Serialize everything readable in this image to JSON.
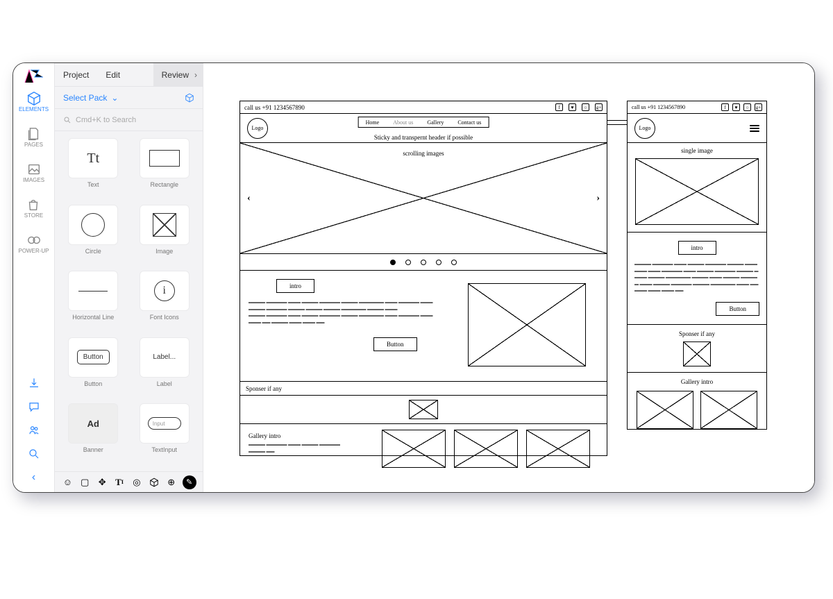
{
  "rail": {
    "items": [
      {
        "label": "ELEMENTS"
      },
      {
        "label": "PAGES"
      },
      {
        "label": "IMAGES"
      },
      {
        "label": "STORE"
      },
      {
        "label": "POWER-UP"
      }
    ]
  },
  "topbar": {
    "project": "Project",
    "edit": "Edit",
    "review": "Review"
  },
  "pack": {
    "label": "Select Pack"
  },
  "search": {
    "placeholder": "Cmd+K to Search"
  },
  "elements": [
    {
      "label": "Text",
      "glyph": "Tt"
    },
    {
      "label": "Rectangle"
    },
    {
      "label": "Circle"
    },
    {
      "label": "Image"
    },
    {
      "label": "Horizontal Line"
    },
    {
      "label": "Font Icons",
      "glyph": "i"
    },
    {
      "label": "Button",
      "glyph": "Button"
    },
    {
      "label": "Label",
      "glyph": "Label..."
    },
    {
      "label": "Banner",
      "glyph": "Ad"
    },
    {
      "label": "TextInput",
      "glyph": "Input"
    }
  ],
  "desktop": {
    "call": "call us +91 1234567890",
    "logo": "Logo",
    "nav": {
      "home": "Home",
      "about": "About us",
      "gallery": "Gallery",
      "contact": "Contact us"
    },
    "sticky": "Sticky and transpernt header if possible",
    "hero_label": "scrolling images",
    "intro": "intro",
    "button": "Button",
    "sponser": "Sponser if any",
    "gallery_intro": "Gallery intro"
  },
  "mobile": {
    "call": "call us +91 1234567890",
    "logo": "Logo",
    "single": "single image",
    "intro": "intro",
    "button": "Button",
    "sponser": "Sponser if any",
    "gallery_intro": "Gallery intro"
  }
}
